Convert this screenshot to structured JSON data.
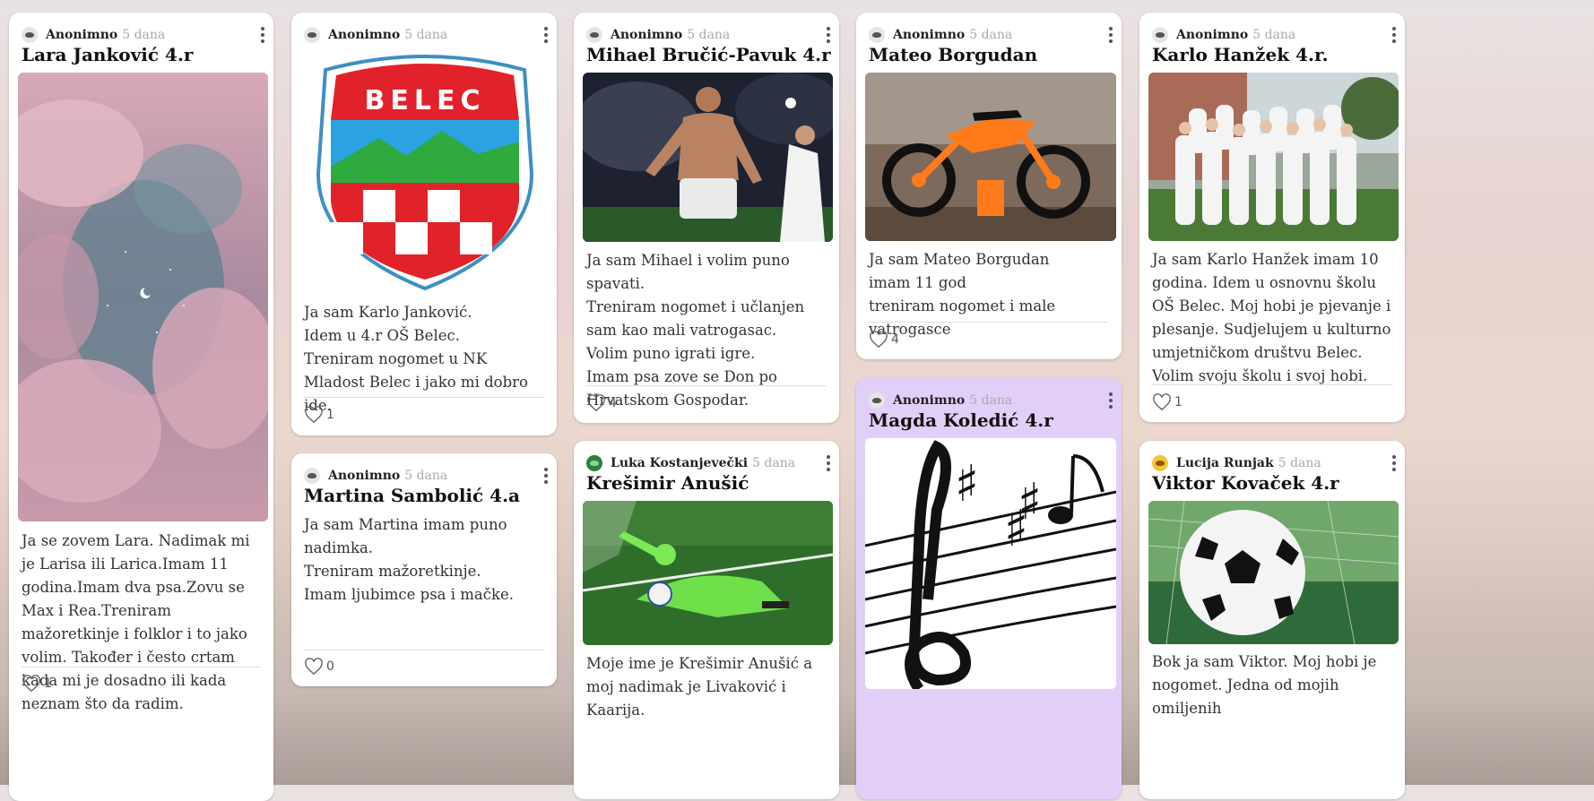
{
  "posts": [
    {
      "author": "Anonimno",
      "time": "5 dana",
      "title": "Lara Janković 4.r",
      "body": "Ja se zovem Lara. Nadimak mi je Larisa ili Larica.Imam 11 godina.Imam dva psa.Zovu se Max i Rea.Treniram mažoretkinje i folklor i to jako volim. Također i često crtam kada mi je dosadno ili kada neznam što da radim.",
      "likes": "1",
      "image": "pink-clouds-night-sky"
    },
    {
      "author": "Anonimno",
      "time": "5 dana",
      "title": "",
      "body": "Ja sam Karlo Janković.\nIdem u 4.r OŠ Belec.\nTreniram nogomet u NK Mladost Belec i jako mi dobro ide.",
      "likes": "1",
      "image": "belec-crest",
      "crest_text": "BELEC"
    },
    {
      "author": "Anonimno",
      "time": "5 dana",
      "title": "Martina Sambolić 4.a",
      "body": "Ja sam Martina imam puno nadimka.\nTreniram mažoretkinje.\nImam ljubimce psa i mačke.",
      "likes": "0"
    },
    {
      "author": "Anonimno",
      "time": "5 dana",
      "title": "Mihael Bručić-Pavuk 4.r",
      "body": "Ja sam Mihael i volim puno spavati.\nTreniram nogomet i učlanjen sam kao mali vatrogasac.\nVolim puno igrati igre.\nImam psa zove se Don po Hrvatskom Gospodar.",
      "likes": "4",
      "image": "football-player-celebrating"
    },
    {
      "author": "Luka Kostanjevečki",
      "time": "5 dana",
      "title": "Krešimir Anušić",
      "body": "Moje ime je Krešimir Anušić a moj nadimak je Livaković i Kaarija.",
      "image": "goalkeeper-diving"
    },
    {
      "author": "Anonimno",
      "time": "5 dana",
      "title": "Mateo Borgudan",
      "body": "Ja sam Mateo  Borgudan\nimam 11 god\ntreniram nogomet i male vatrogasce",
      "likes": "4",
      "image": "motocross-bike"
    },
    {
      "author": "Anonimno",
      "time": "5 dana",
      "title": "Magda Koledić 4.r",
      "image": "treble-clef-music-notes"
    },
    {
      "author": "Anonimno",
      "time": "5 dana",
      "title": "Karlo Hanžek 4.r.",
      "body": "Ja sam Karlo Hanžek imam 10 godina. Idem u osnovnu školu   OŠ Belec. Moj hobi je pjevanje i plesanje. Sudjelujem u kulturno umjetničkom društvu Belec. Volim svoju školu i svoj hobi.",
      "likes": "1",
      "image": "children-choir-white-robes"
    },
    {
      "author": "Lucija Runjak",
      "time": "5 dana",
      "title": "Viktor Kovaček 4.r",
      "body": "Bok ja sam Viktor. Moj hobi je nogomet.  Jedna od mojih omiljenih",
      "image": "soccer-ball-in-net"
    }
  ],
  "colors": {
    "purple_card": "#e2cff8",
    "heart": "#666666"
  }
}
